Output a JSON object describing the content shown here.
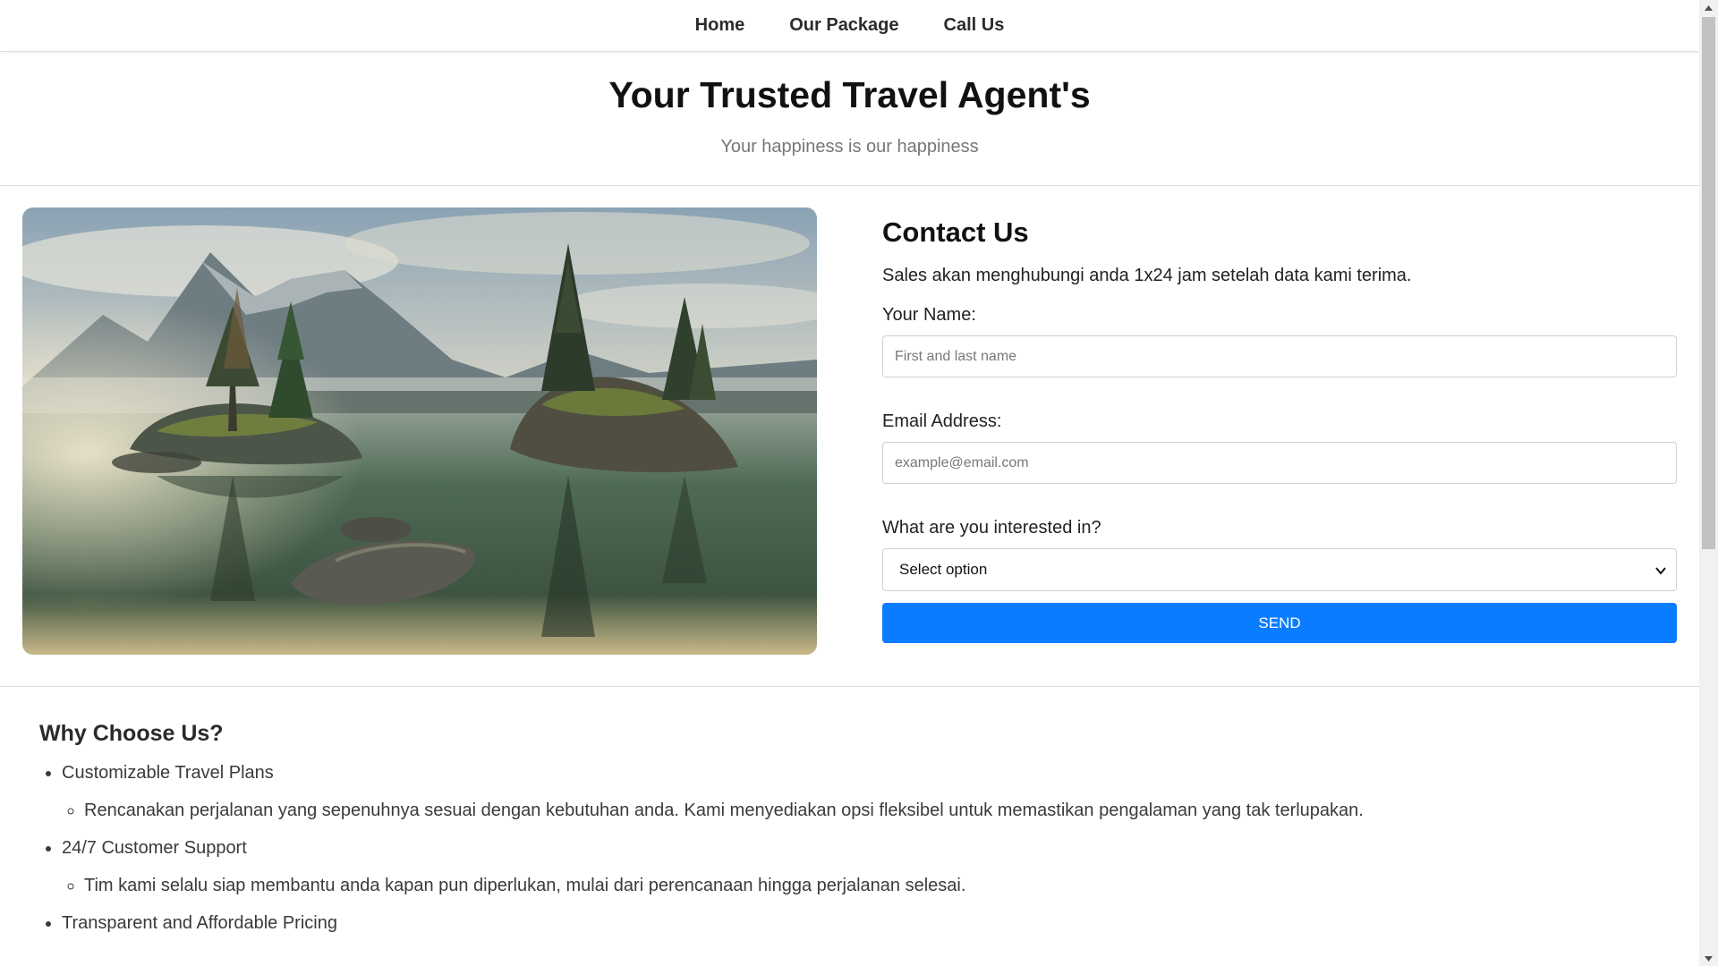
{
  "nav": {
    "items": [
      {
        "label": "Home"
      },
      {
        "label": "Our Package"
      },
      {
        "label": "Call Us"
      }
    ]
  },
  "hero": {
    "title": "Your Trusted Travel Agent's",
    "subtitle": "Your happiness is our happiness"
  },
  "contact": {
    "title": "Contact Us",
    "lead": "Sales akan menghubungi anda 1x24 jam setelah data kami terima.",
    "name_label": "Your Name:",
    "name_placeholder": "First and last name",
    "email_label": "Email Address:",
    "email_placeholder": "example@email.com",
    "interest_label": "What are you interested in?",
    "interest_selected": "Select option",
    "send_label": "SEND"
  },
  "why": {
    "title": "Why Choose Us?",
    "items": [
      {
        "label": "Customizable Travel Plans",
        "detail": "Rencanakan perjalanan yang sepenuhnya sesuai dengan kebutuhan anda. Kami menyediakan opsi fleksibel untuk memastikan pengalaman yang tak terlupakan."
      },
      {
        "label": "24/7 Customer Support",
        "detail": "Tim kami selalu siap membantu anda kapan pun diperlukan, mulai dari perencanaan hingga perjalanan selesai."
      },
      {
        "label": "Transparent and Affordable Pricing"
      }
    ]
  },
  "colors": {
    "accent": "#0a7cff",
    "text": "#222222",
    "muted": "#777777"
  }
}
